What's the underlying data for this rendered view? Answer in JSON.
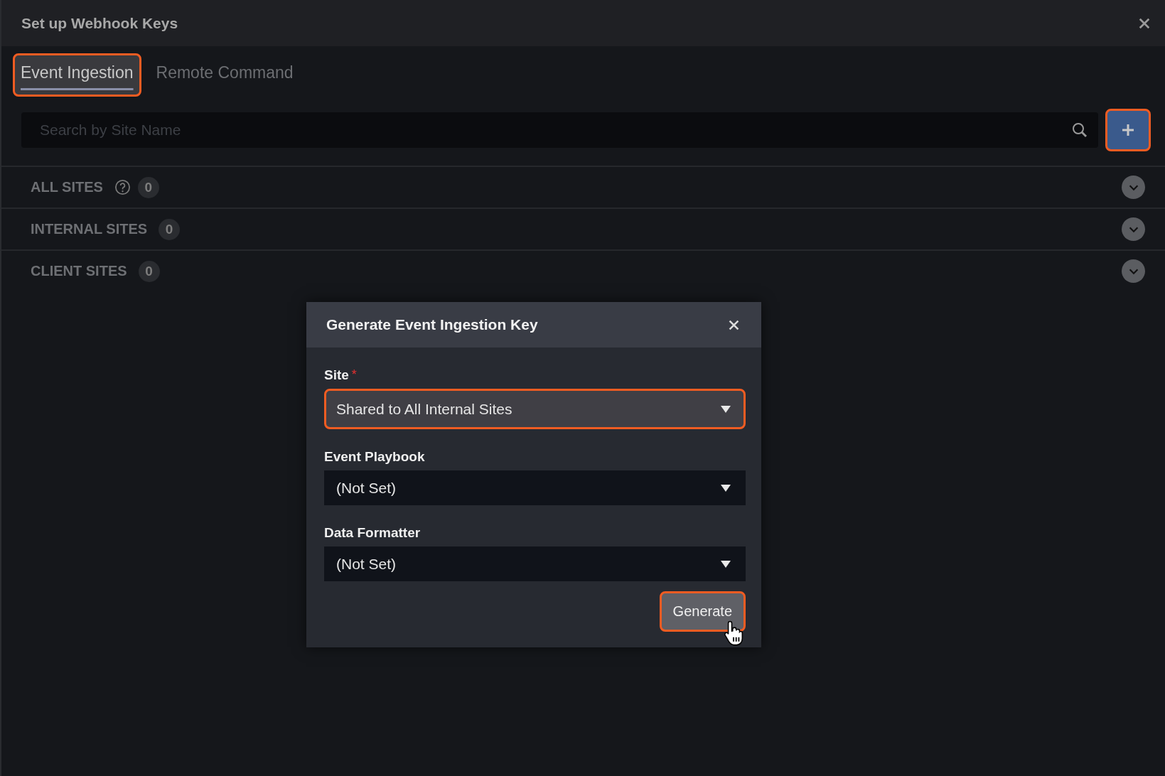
{
  "window": {
    "title": "Set up Webhook Keys"
  },
  "tabs": [
    {
      "label": "Event Ingestion",
      "selected": true,
      "highlighted": true
    },
    {
      "label": "Remote Command",
      "selected": false,
      "highlighted": false
    }
  ],
  "search": {
    "placeholder": "Search by Site Name"
  },
  "add_button": {
    "highlighted": true
  },
  "sections": [
    {
      "label": "ALL SITES",
      "help": true,
      "count": "0",
      "expanded": false
    },
    {
      "label": "INTERNAL SITES",
      "help": false,
      "count": "0",
      "expanded": false
    },
    {
      "label": "CLIENT SITES",
      "help": false,
      "count": "0",
      "expanded": false
    }
  ],
  "dialog": {
    "title": "Generate Event Ingestion Key",
    "fields": [
      {
        "label": "Site",
        "required_mark": "*",
        "value": "Shared to All Internal Sites",
        "highlighted": true
      },
      {
        "label": "Event Playbook",
        "value": "(Not Set)",
        "highlighted": false
      },
      {
        "label": "Data Formatter",
        "value": "(Not Set)",
        "highlighted": false
      }
    ],
    "button": {
      "label": "Generate",
      "highlighted": true
    }
  }
}
